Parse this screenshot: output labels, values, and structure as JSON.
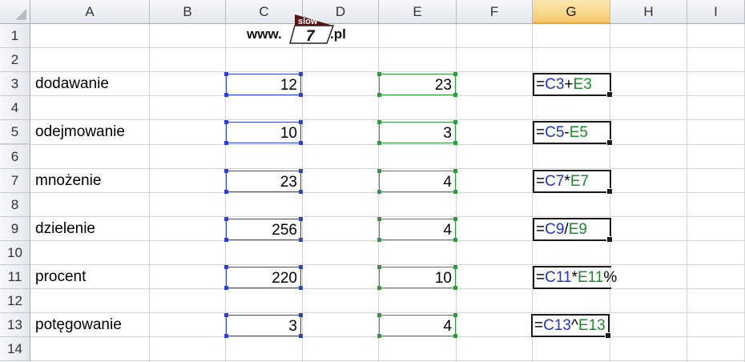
{
  "columns": [
    "A",
    "B",
    "C",
    "D",
    "E",
    "F",
    "G",
    "H",
    "I"
  ],
  "selected_column": "G",
  "rows": [
    "1",
    "2",
    "3",
    "4",
    "5",
    "6",
    "7",
    "8",
    "9",
    "10",
    "11",
    "12",
    "13",
    "14"
  ],
  "logo": {
    "prefix": "www.",
    "top": "slow",
    "number": "7",
    "suffix": ".pl"
  },
  "operations": [
    {
      "row": "3",
      "label": "dodawanie",
      "c": "12",
      "e": "23",
      "f": {
        "eq": "=",
        "ref1": "C3",
        "op": "+",
        "ref2": "E3",
        "tail": ""
      }
    },
    {
      "row": "5",
      "label": "odejmowanie",
      "c": "10",
      "e": "3",
      "f": {
        "eq": "=",
        "ref1": "C5",
        "op": "-",
        "ref2": "E5",
        "tail": ""
      }
    },
    {
      "row": "7",
      "label": "mnożenie",
      "c": "23",
      "e": "4",
      "f": {
        "eq": "=",
        "ref1": "C7",
        "op": "*",
        "ref2": "E7",
        "tail": ""
      }
    },
    {
      "row": "9",
      "label": "dzielenie",
      "c": "256",
      "e": "4",
      "f": {
        "eq": "=",
        "ref1": "C9",
        "op": "/",
        "ref2": "E9",
        "tail": ""
      }
    },
    {
      "row": "11",
      "label": "procent",
      "c": "220",
      "e": "10",
      "f": {
        "eq": "=",
        "ref1": "C11",
        "op": "*",
        "ref2": "E11",
        "tail": "%"
      }
    },
    {
      "row": "13",
      "label": "potęgowanie",
      "c": "3",
      "e": "4",
      "f": {
        "eq": "=",
        "ref1": "C13",
        "op": "^",
        "ref2": "E13",
        "tail": ""
      }
    }
  ],
  "colors": {
    "ref_blue": "#2233cc",
    "ref_green": "#1d8a2e",
    "selected_header": "#f6c86a"
  }
}
